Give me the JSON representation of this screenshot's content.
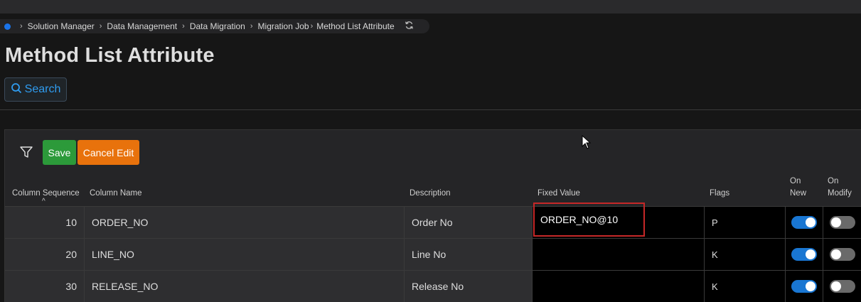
{
  "breadcrumb": [
    "Solution Manager",
    "Data Management",
    "Data Migration",
    "Migration Job",
    "Method List Attribute"
  ],
  "page_title": "Method List Attribute",
  "search_label": "Search",
  "toolbar": {
    "save_label": "Save",
    "cancel_label": "Cancel Edit"
  },
  "columns": {
    "seq": "Column Sequence",
    "name": "Column Name",
    "desc": "Description",
    "fixed": "Fixed Value",
    "flags": "Flags",
    "on_new_1": "On",
    "on_new_2": "New",
    "on_mod_1": "On",
    "on_mod_2": "Modify"
  },
  "rows": [
    {
      "seq": "10",
      "name": "ORDER_NO",
      "desc": "Order No",
      "fixed": "ORDER_NO@10",
      "flags": "P",
      "on_new": true,
      "on_modify": false
    },
    {
      "seq": "20",
      "name": "LINE_NO",
      "desc": "Line No",
      "fixed": "",
      "flags": "K",
      "on_new": true,
      "on_modify": false
    },
    {
      "seq": "30",
      "name": "RELEASE_NO",
      "desc": "Release No",
      "fixed": "",
      "flags": "K",
      "on_new": true,
      "on_modify": false
    }
  ],
  "colors": {
    "accent": "#1976d2",
    "save": "#2c9a3a",
    "cancel": "#e8720c",
    "highlight": "#c62828"
  }
}
